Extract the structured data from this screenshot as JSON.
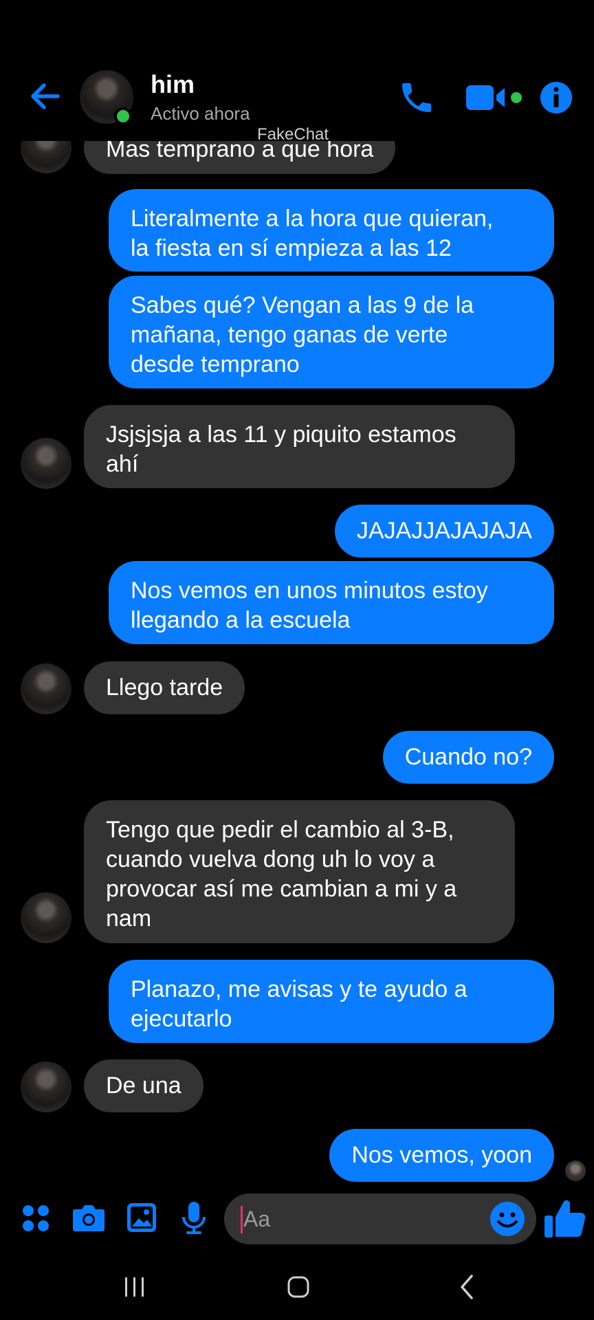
{
  "header": {
    "contact_name": "him",
    "status": "Activo ahora",
    "watermark": "FakeChat",
    "icons": [
      "back-arrow-icon",
      "phone-icon",
      "video-camera-icon",
      "info-icon"
    ]
  },
  "messages": [
    {
      "side": "in",
      "text": "Mas temprano a que hora",
      "avatar": true
    },
    {
      "side": "out",
      "text": "Literalmente a la hora que quieran,\nla fiesta en sí empieza a las 12"
    },
    {
      "side": "out",
      "text": "Sabes qué? Vengan a las 9 de la\nmañana, tengo ganas de verte\ndesde temprano"
    },
    {
      "side": "in",
      "text": "Jsjsjsja a las 11 y piquito estamos\nahí",
      "avatar": true
    },
    {
      "side": "out",
      "text": "JAJAJJAJAJAJA"
    },
    {
      "side": "out",
      "text": "Nos vemos en unos minutos estoy\nllegando a la escuela"
    },
    {
      "side": "in",
      "text": "Llego tarde",
      "avatar": true
    },
    {
      "side": "out",
      "text": "Cuando no?"
    },
    {
      "side": "in",
      "text": "Tengo que pedir el cambio al 3-B,\ncuando vuelva dong uh lo voy a\nprovocar así me cambian a mi y a\nnam",
      "avatar": true
    },
    {
      "side": "out",
      "text": "Planazo, me avisas y te ayudo a\nejecutarlo"
    },
    {
      "side": "in",
      "text": "De una",
      "avatar": true
    },
    {
      "side": "out",
      "text": "Nos vemos, yoon"
    }
  ],
  "composer": {
    "placeholder": "Aa",
    "icons": [
      "apps-grid-icon",
      "camera-icon",
      "gallery-icon",
      "microphone-icon",
      "emoji-icon",
      "thumbs-up-icon"
    ]
  },
  "navbar": {
    "icons": [
      "recent-apps-icon",
      "home-icon",
      "back-icon"
    ]
  },
  "colors": {
    "accent": "#0a7cff",
    "incoming_bubble": "#333333",
    "background": "#000000",
    "online": "#31c24b"
  }
}
